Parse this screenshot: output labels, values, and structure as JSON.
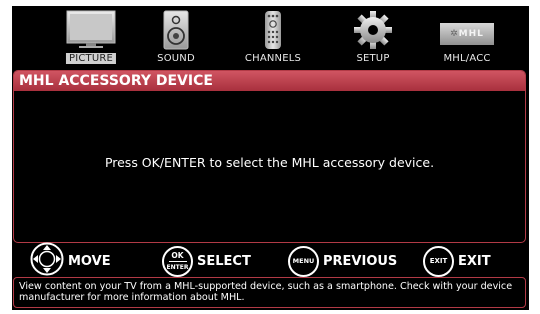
{
  "tabs": [
    {
      "label": "PICTURE",
      "icon": "tv-icon",
      "active": true
    },
    {
      "label": "SOUND",
      "icon": "speaker-icon"
    },
    {
      "label": "CHANNELS",
      "icon": "remote-icon"
    },
    {
      "label": "SETUP",
      "icon": "gear-icon"
    },
    {
      "label": "MHL/ACC",
      "icon": "mhl-logo-icon",
      "logo_text": "MHL"
    }
  ],
  "panel": {
    "title": "MHL ACCESSORY DEVICE",
    "message": "Press OK/ENTER to select the MHL accessory device."
  },
  "controls": {
    "move": "MOVE",
    "select_key_top": "OK",
    "select_key_bottom": "ENTER",
    "select": "SELECT",
    "previous_key": "MENU",
    "previous": "PREVIOUS",
    "exit_key": "EXIT",
    "exit": "EXIT"
  },
  "help_text": "View content on your TV from a MHL-supported device, such as a smartphone. Check with your device manufacturer for more information about MHL.",
  "colors": {
    "accent": "#b23a46",
    "background": "#000000",
    "text": "#ffffff"
  }
}
